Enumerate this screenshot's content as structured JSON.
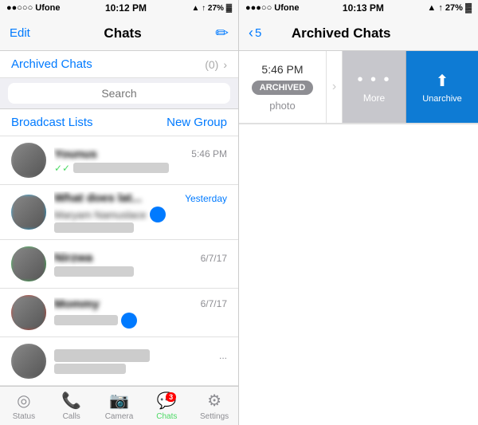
{
  "left": {
    "statusBar": {
      "carrier": "●●○○○ Ufone",
      "time": "10:12 PM",
      "icons": "▲ ↑ 27% ▓"
    },
    "navBar": {
      "edit": "Edit",
      "title": "Chats",
      "compose": "✏"
    },
    "archivedRow": {
      "label": "Archived Chats",
      "count": "(0)",
      "arrow": "›"
    },
    "search": {
      "placeholder": "Search"
    },
    "broadcast": {
      "label": "Broadcast Lists",
      "newGroup": "New Group"
    },
    "chats": [
      {
        "name": "Younus",
        "time": "5:46 PM",
        "preview": "blurred",
        "avatarType": "gray",
        "hasTick": true,
        "hasBlueDot": false
      },
      {
        "name": "What does lat...",
        "time": "Yesterday",
        "preview": "Maryam Namuslace",
        "preview2": "blurred",
        "avatarType": "teal",
        "hasTick": false,
        "hasBlueDot": true
      },
      {
        "name": "Nirzwa",
        "time": "6/7/17",
        "preview": "blurred",
        "avatarType": "green",
        "hasTick": false,
        "hasBlueDot": false
      },
      {
        "name": "Mommy",
        "time": "6/7/17",
        "preview": "blurred",
        "avatarType": "red",
        "hasTick": false,
        "hasBlueDot": true
      },
      {
        "name": "blurred",
        "time": "...",
        "preview": "blurred",
        "avatarType": "gray",
        "hasTick": false,
        "hasBlueDot": false
      }
    ],
    "tabBar": {
      "tabs": [
        {
          "icon": "◎",
          "label": "Status",
          "active": false
        },
        {
          "icon": "📞",
          "label": "Calls",
          "active": false
        },
        {
          "icon": "📷",
          "label": "Camera",
          "active": false
        },
        {
          "icon": "💬",
          "label": "Chats",
          "active": true,
          "badge": "3"
        },
        {
          "icon": "⚙",
          "label": "Settings",
          "active": false
        }
      ]
    }
  },
  "right": {
    "statusBar": {
      "carrier": "●●●○○ Ufone",
      "time": "10:13 PM",
      "icons": "▲ ↑ 27% ▓"
    },
    "navBar": {
      "backCount": "5",
      "title": "Archived Chats"
    },
    "actionArea": {
      "time": "5:46 PM",
      "archivedBadge": "ARCHIVED",
      "photoLabel": "photo",
      "moreLabel": "More",
      "moreDots": "• • •",
      "unarchiveLabel": "Unarchive",
      "arrow": "›"
    }
  }
}
